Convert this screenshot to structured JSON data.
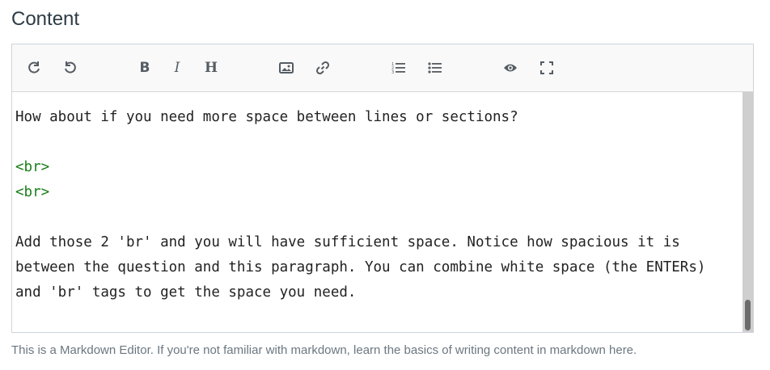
{
  "section": {
    "heading": "Content"
  },
  "toolbar": {
    "buttons": [
      {
        "icon": "redo-icon"
      },
      {
        "icon": "undo-icon"
      },
      {
        "icon": "bold-icon",
        "glyph": "B"
      },
      {
        "icon": "italic-icon",
        "glyph": "I"
      },
      {
        "icon": "heading-icon",
        "glyph": "H"
      },
      {
        "icon": "image-icon"
      },
      {
        "icon": "link-icon"
      },
      {
        "icon": "ordered-list-icon"
      },
      {
        "icon": "unordered-list-icon"
      },
      {
        "icon": "preview-icon"
      },
      {
        "icon": "fullscreen-icon"
      }
    ]
  },
  "editor": {
    "lines": [
      "How about if you need more space between lines or sections?",
      "",
      "<br>",
      "<br>",
      "",
      "Add those 2 'br' and you will have sufficient space. Notice how spacious it is",
      "between the question and this paragraph. You can combine white space (the ENTERs)",
      "and 'br' tags to get the space you need."
    ]
  },
  "helper": {
    "text": "This is a Markdown Editor. If you're not familiar with markdown, learn the basics of writing content in markdown here."
  },
  "colors": {
    "heading": "#2d3b45",
    "tag_text": "#1a7f1a",
    "helper_text": "#6b7780"
  }
}
